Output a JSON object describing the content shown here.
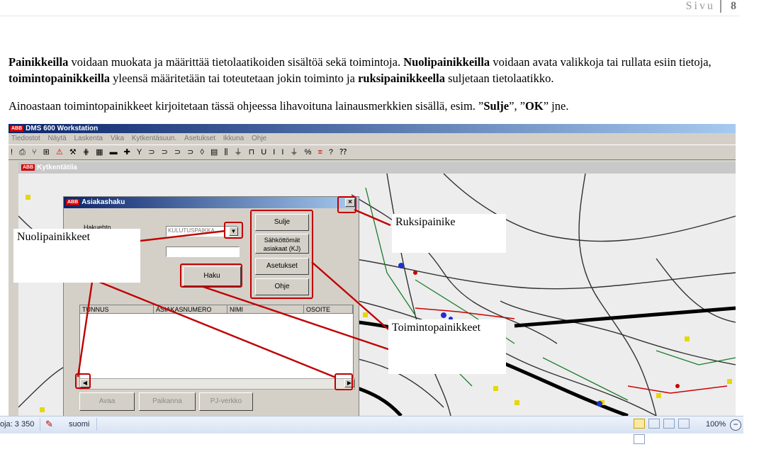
{
  "header": {
    "page_word": "Sivu",
    "page_number": "8"
  },
  "paragraph1": {
    "b1": "Painikkeilla",
    "t1": " voidaan muokata ja määrittää tietolaatikoiden sisältöä sekä toimintoja. ",
    "b2": "Nuolipainikkeilla",
    "t2": " voidaan avata valikkoja tai rullata esiin tietoja, ",
    "b3": "toimintopainikkeilla",
    "t3": " yleensä määritetään tai toteutetaan jokin toiminto ja ",
    "b4": "ruksipainikkeella",
    "t4": " suljetaan tietolaatikko."
  },
  "paragraph2": {
    "t1": "Ainoastaan toimintopainikkeet kirjoitetaan tässä ohjeessa lihavoituna lainausmerkkien sisällä, esim. ”",
    "b1": "Sulje",
    "t2": "”, ”",
    "b2": "OK",
    "t3": "” jne."
  },
  "app": {
    "logo_text": "ABB",
    "title": "DMS 600 Workstation",
    "menu": [
      "Tiedostot",
      "Näytä",
      "Laskenta",
      "Vika",
      "Kytkentäsuun.",
      "Asetukset",
      "Ikkuna",
      "Ohje"
    ],
    "map_window_title": "Kytkentätila"
  },
  "dialog": {
    "title": "Asiakashaku",
    "close_glyph": "×",
    "search_label": "Hakuehto",
    "dropdown_value": "KULUTUSPAIKKA",
    "search_button": "Haku",
    "side_buttons": [
      "Sulje",
      "Sähköttömät asiakaat (KJ)",
      "Asetukset",
      "Ohje"
    ],
    "columns": [
      "TUNNUS",
      "ASIAKASNUMERO",
      "NIMI",
      "OSOITE"
    ],
    "bottom_buttons": [
      "Avaa",
      "Paikanna",
      "PJ-verkko"
    ]
  },
  "callouts": {
    "arrows": "Nuolipainikkeet",
    "close": "Ruksipainike",
    "actions": "Toimintopainikkeet"
  },
  "statusbar": {
    "words": "oja: 3 350",
    "language": "suomi",
    "zoom": "100%"
  },
  "colors": {
    "annotation_red": "#c00000",
    "titlebar_blue": "#0a246a"
  }
}
